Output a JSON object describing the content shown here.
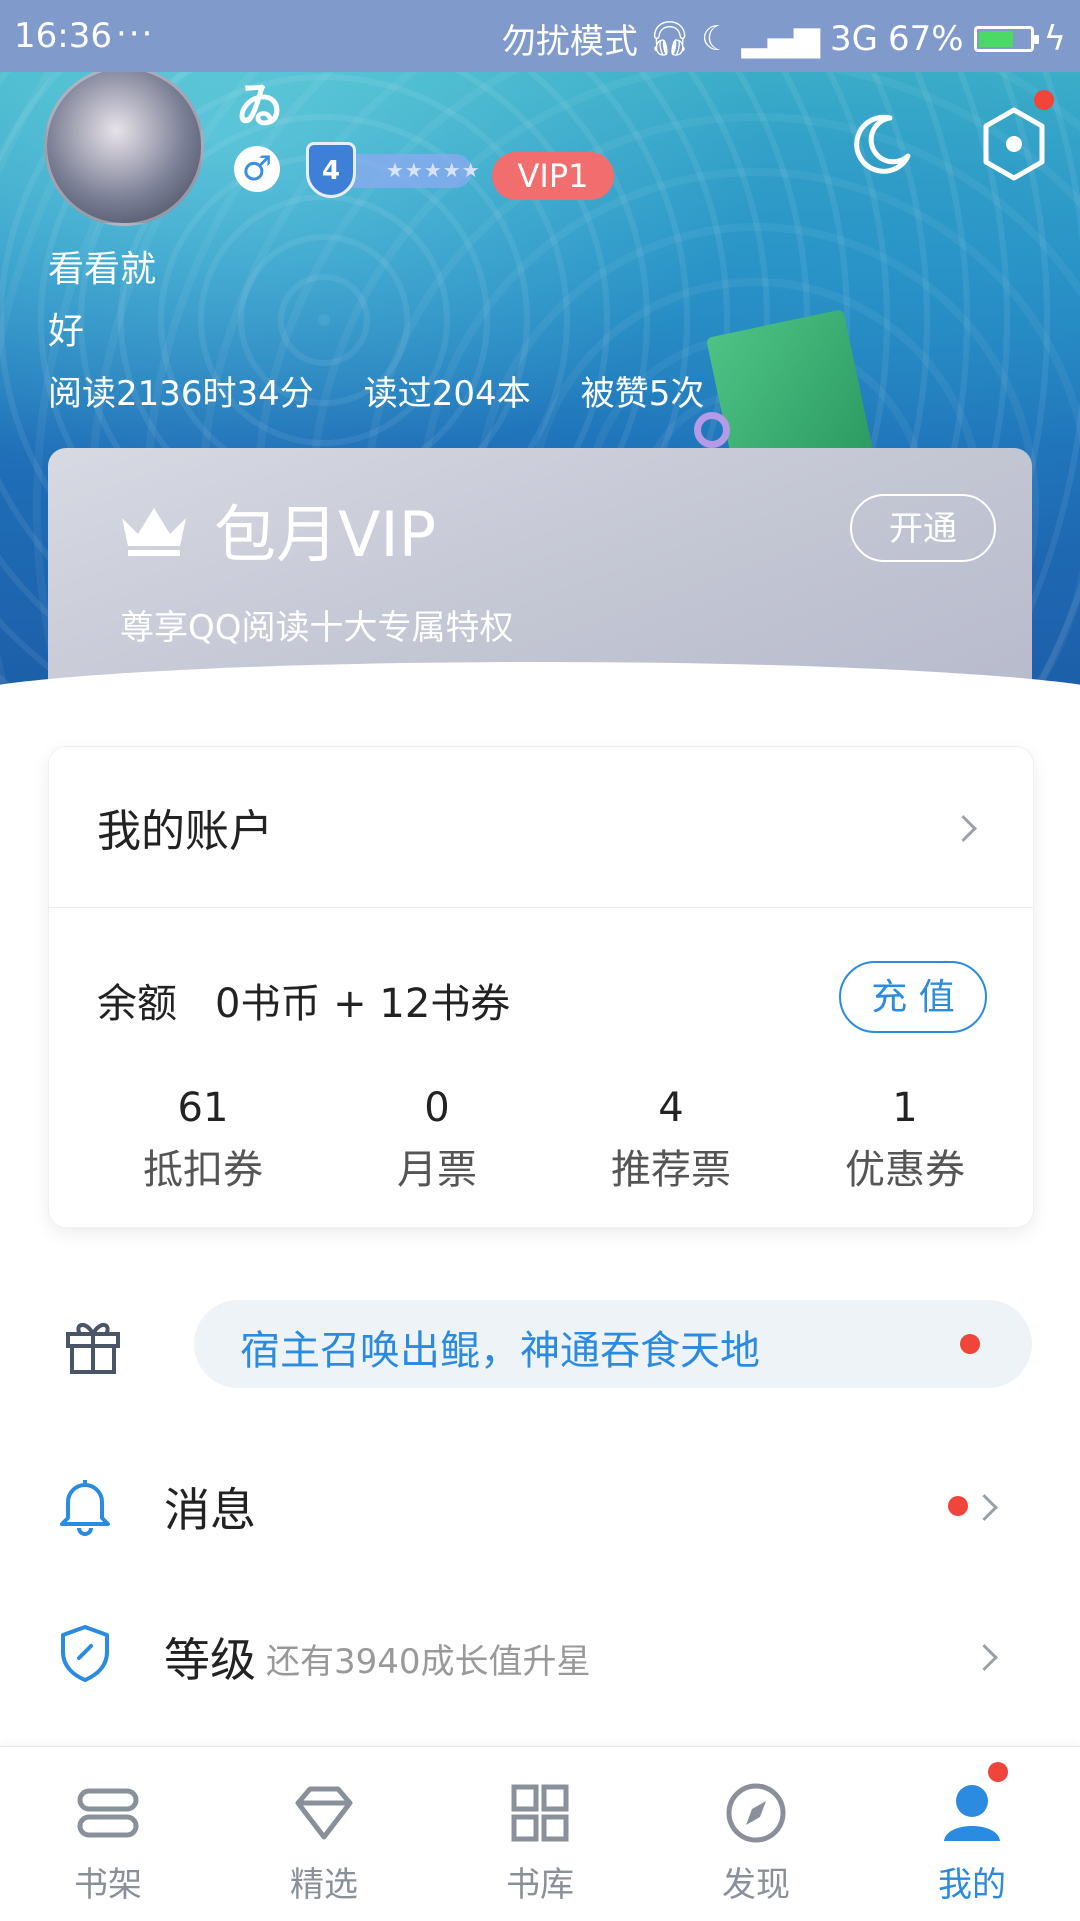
{
  "status_bar": {
    "time": "16:36",
    "dots": "···",
    "dnd": "勿扰模式",
    "signal_type": "3G",
    "battery": "67%",
    "battery_level": 0.67
  },
  "profile": {
    "name_glyph": "ゐ",
    "gender_symbol": "♂",
    "level": "4",
    "level_stars": "★★★★★",
    "vip_badge": "VIP1",
    "bio_line1": "看看就",
    "bio_line2": "好",
    "stats": {
      "reading_time": "阅读2136时34分",
      "books_read": "读过204本",
      "likes": "被赞5次"
    }
  },
  "vip_card": {
    "title": "包月VIP",
    "subtitle": "尊享QQ阅读十大专属特权",
    "button": "开通"
  },
  "account": {
    "title": "我的账户",
    "balance_label": "余额",
    "balance_value": "0书币 + 12书券",
    "recharge": "充 值",
    "items": [
      {
        "value": "61",
        "label": "抵扣券"
      },
      {
        "value": "0",
        "label": "月票"
      },
      {
        "value": "4",
        "label": "推荐票"
      },
      {
        "value": "1",
        "label": "优惠券"
      }
    ]
  },
  "promo": {
    "text": "宿主召唤出鲲，神通吞食天地"
  },
  "menu": {
    "messages": "消息",
    "level": "等级",
    "level_hint": "还有3940成长值升星"
  },
  "bottom_nav": {
    "items": [
      {
        "label": "书架",
        "icon": "bookshelf-icon"
      },
      {
        "label": "精选",
        "icon": "diamond-icon"
      },
      {
        "label": "书库",
        "icon": "grid-icon"
      },
      {
        "label": "发现",
        "icon": "compass-icon"
      },
      {
        "label": "我的",
        "icon": "user-icon"
      }
    ],
    "active_index": 4
  },
  "colors": {
    "accent": "#2a8be0",
    "status_bar": "#7f9acb",
    "vip_badge": "#f26d6d",
    "red_dot": "#f0453a"
  }
}
